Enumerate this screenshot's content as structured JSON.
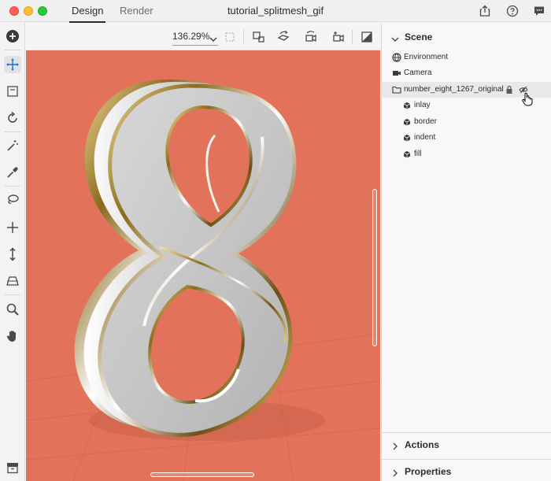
{
  "window": {
    "title": "tutorial_splitmesh_gif",
    "tabs": [
      {
        "label": "Design",
        "active": true
      },
      {
        "label": "Render",
        "active": false
      }
    ],
    "title_icons": [
      "share-icon",
      "help-icon",
      "comment-icon"
    ]
  },
  "toolbar": {
    "tools": [
      "add-icon",
      "select-move-icon",
      "frame-select-icon",
      "orbit-icon",
      "magic-wand-icon",
      "eyedropper-icon",
      "lasso-icon",
      "pan-move-icon",
      "dolly-icon",
      "perspective-icon",
      "zoom-icon",
      "hand-icon"
    ],
    "bottom_tool": "library-icon"
  },
  "viewport": {
    "zoom_label": "136.29%",
    "header_tools": [
      "fit-view-icon",
      "transform-icon",
      "rotate-object-icon",
      "camera-orbit-icon",
      "camera-icon",
      "ground-plane-icon"
    ],
    "background_color": "#e2735a",
    "object": "number 8"
  },
  "scene_panel": {
    "title": "Scene",
    "items": [
      {
        "label": "Environment",
        "icon": "globe-icon",
        "depth": 0
      },
      {
        "label": "Camera",
        "icon": "camera-icon",
        "depth": 0
      },
      {
        "label": "number_eight_1267_original",
        "icon": "folder-icon",
        "depth": 0,
        "locked": true,
        "hidden_toggle": true
      },
      {
        "label": "inlay",
        "icon": "cube-icon",
        "depth": 1
      },
      {
        "label": "border",
        "icon": "cube-icon",
        "depth": 1
      },
      {
        "label": "indent",
        "icon": "cube-icon",
        "depth": 1
      },
      {
        "label": "fill",
        "icon": "cube-icon",
        "depth": 1
      }
    ]
  },
  "sections": {
    "actions": "Actions",
    "properties": "Properties"
  }
}
